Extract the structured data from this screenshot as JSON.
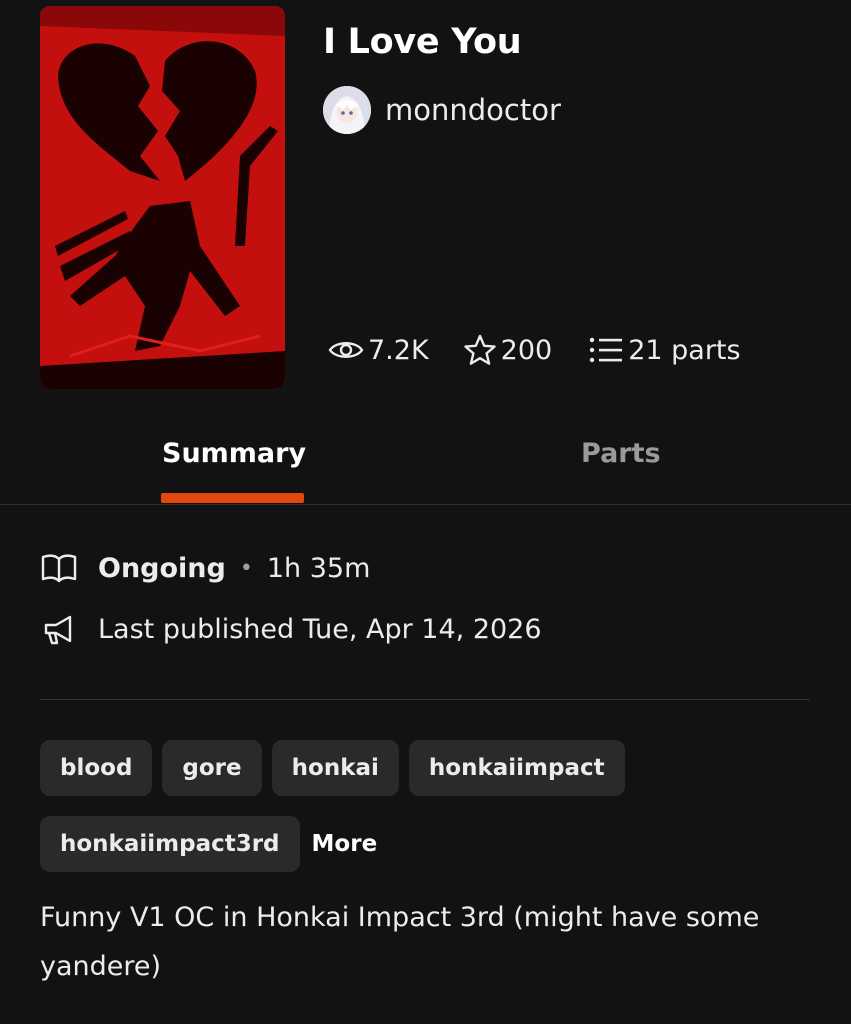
{
  "story": {
    "title": "I Love You",
    "author": "monndoctor",
    "stats": {
      "views": "7.2K",
      "votes": "200",
      "parts": "21 parts"
    }
  },
  "tabs": [
    {
      "label": "Summary",
      "active": true
    },
    {
      "label": "Parts",
      "active": false
    }
  ],
  "summary": {
    "status": "Ongoing",
    "separator": "•",
    "reading_time": "1h 35m",
    "last_published": "Last published Tue, Apr 14, 2026",
    "tags": [
      "blood",
      "gore",
      "honkai",
      "honkaiimpact",
      "honkaiimpact3rd"
    ],
    "more_label": "More",
    "description": "Funny V1 OC in Honkai Impact 3rd (might have some yandere)"
  },
  "icons": {
    "views": "eye-icon",
    "votes": "star-icon",
    "parts": "list-icon",
    "status": "book-open-icon",
    "published": "megaphone-icon"
  },
  "colors": {
    "background": "#121212",
    "accent": "#e0480e",
    "tag_background": "#2a2a2a",
    "inactive_tab": "#9a9a9a",
    "cover_red": "#c40f0f"
  }
}
